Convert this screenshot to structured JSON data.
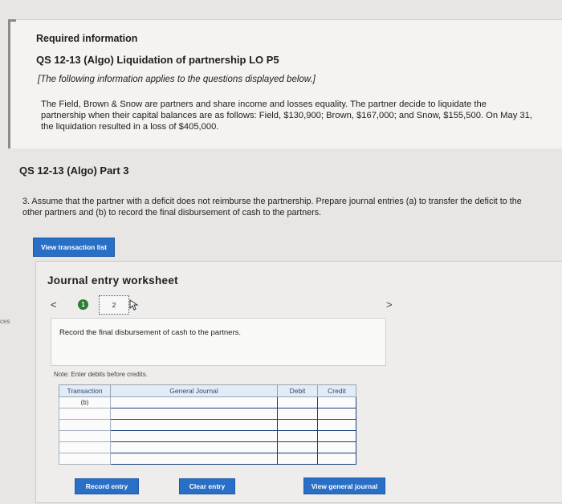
{
  "info": {
    "required_information": "Required information",
    "qs_title": "QS 12-13 (Algo) Liquidation of partnership LO P5",
    "intro_note": "[The following information applies to the questions displayed below.]",
    "scenario_line1": "The Field, Brown & Snow are partners and share income and losses equality. The partner decide to liquidate the",
    "scenario_line2": "partnership when their capital balances are as follows: Field, $130,900; Brown, $167,000; and Snow, $155,500. On May 31,",
    "scenario_line3": "the liquidation resulted in a loss of $405,000."
  },
  "part": {
    "title": "QS 12-13 (Algo) Part 3",
    "question_line1": "3. Assume that the partner with a deficit does not reimburse the partnership. Prepare journal entries (a) to transfer the deficit to the",
    "question_line2": "other partners and (b) to record the final disbursement of cash to the partners."
  },
  "side_label": "ces",
  "buttons": {
    "view_transaction_list": "View transaction list",
    "record_entry": "Record entry",
    "clear_entry": "Clear entry",
    "view_general_journal": "View general journal"
  },
  "worksheet": {
    "title": "Journal entry worksheet",
    "prev_glyph": "<",
    "next_glyph": ">",
    "steps": [
      "1",
      "2"
    ],
    "current_step": "2",
    "instruction": "Record the final disbursement of cash to the partners.",
    "note": "Note: Enter debits before credits."
  },
  "journal": {
    "headers": {
      "transaction": "Transaction",
      "account": "General Journal",
      "debit": "Debit",
      "credit": "Credit"
    },
    "rows": [
      {
        "transaction": "(b)"
      },
      {
        "transaction": ""
      },
      {
        "transaction": ""
      },
      {
        "transaction": ""
      },
      {
        "transaction": ""
      },
      {
        "transaction": ""
      }
    ]
  },
  "colors": {
    "button_blue": "#2a6fc6",
    "step_complete_green": "#2f7d32"
  }
}
